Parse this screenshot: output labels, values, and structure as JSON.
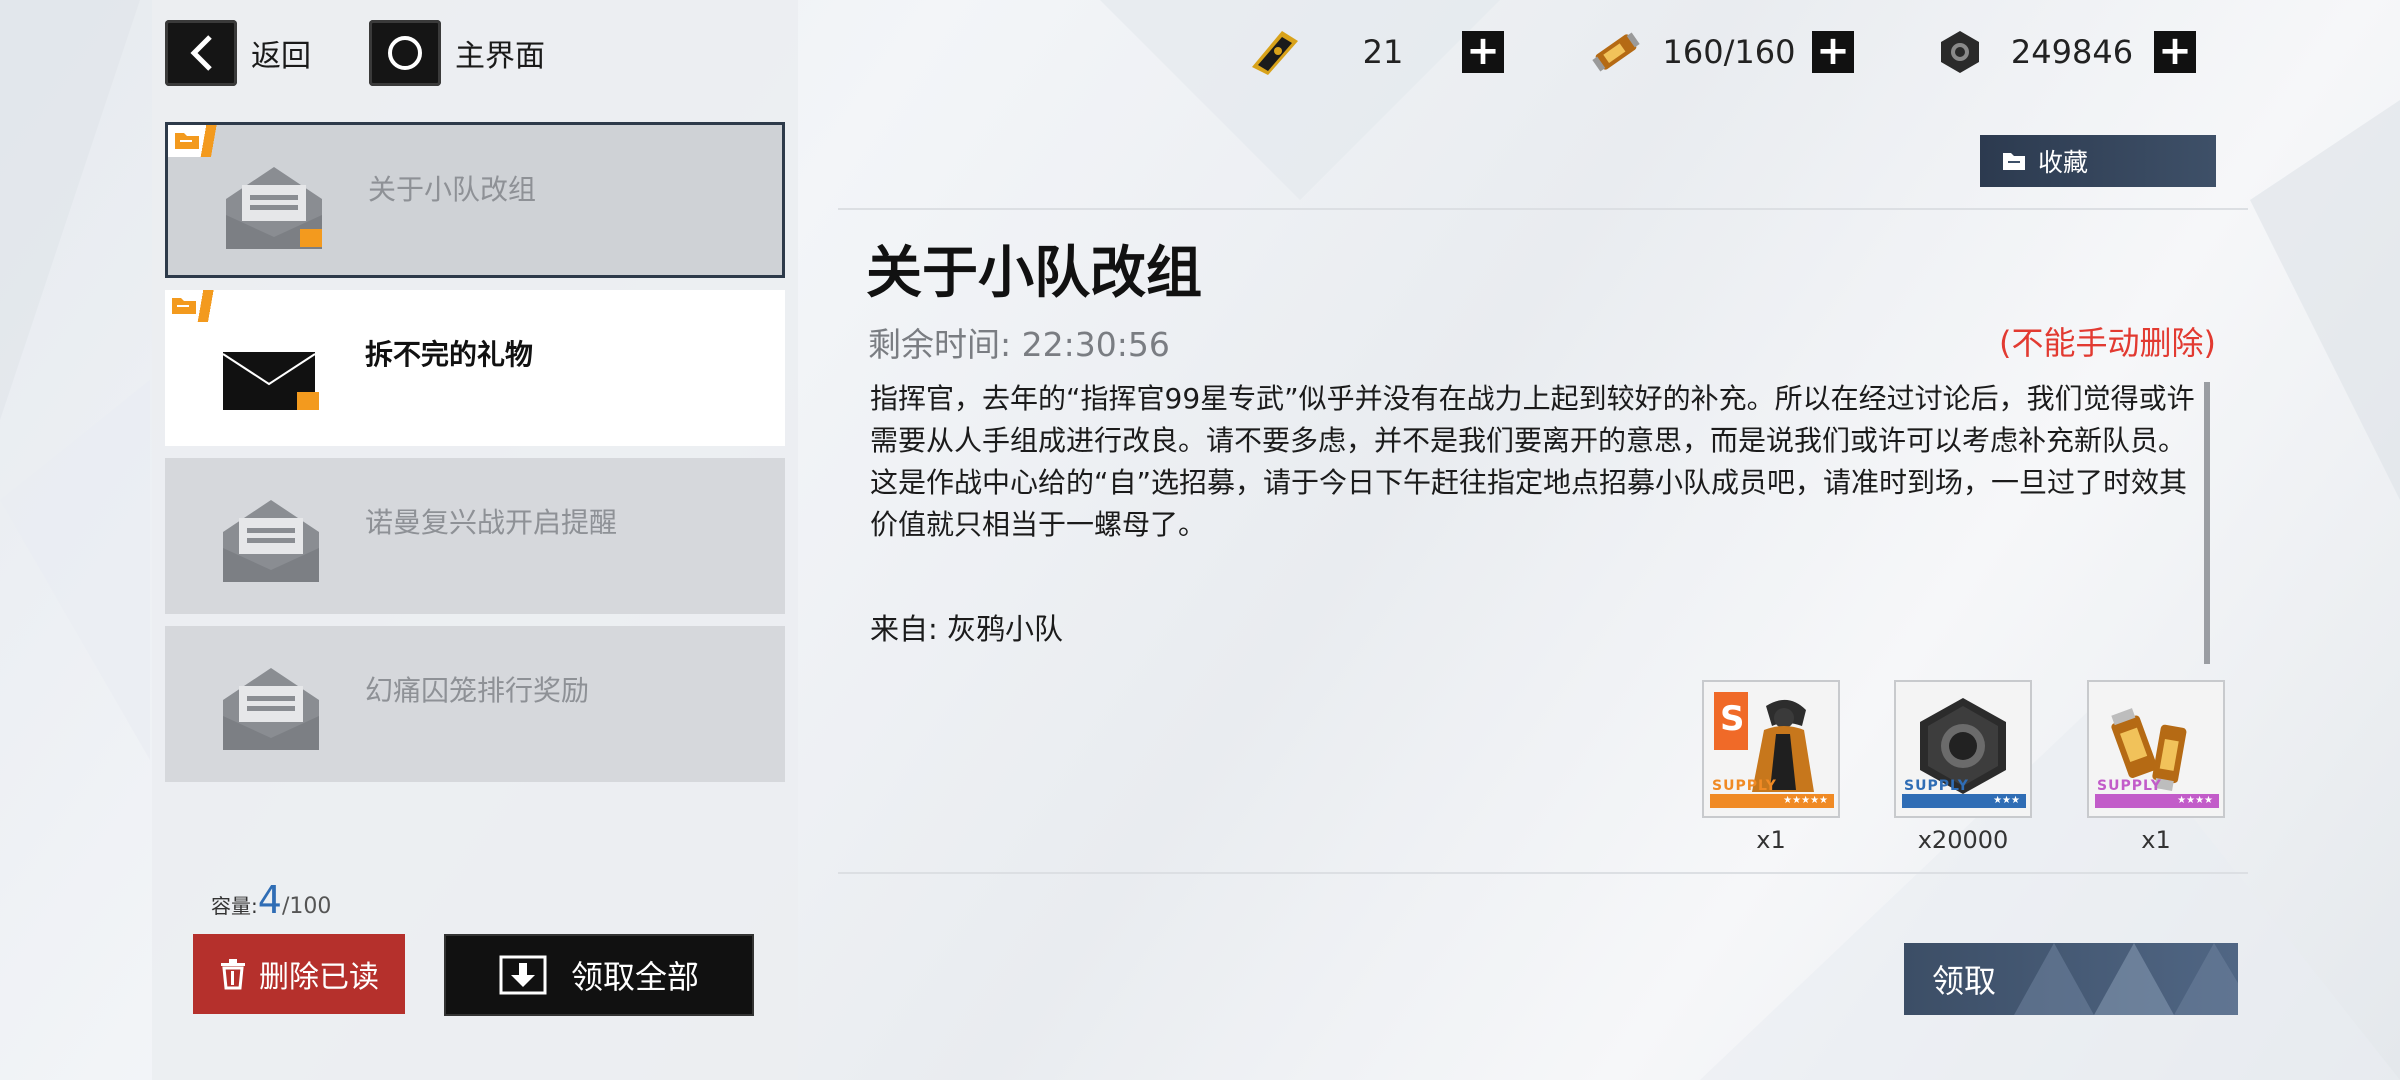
{
  "topnav": {
    "back_label": "返回",
    "home_label": "主界面",
    "back_icon": "chevron-left-icon",
    "home_icon": "circle-icon"
  },
  "resources": [
    {
      "icon": "ticket-icon",
      "value": "21"
    },
    {
      "icon": "battery-icon",
      "value": "160/160"
    },
    {
      "icon": "nut-icon",
      "value": "249846"
    }
  ],
  "mail_list": [
    {
      "title": "关于小队改组",
      "state": "selected",
      "icon": "envelope-open-icon"
    },
    {
      "title": "拆不完的礼物",
      "state": "active",
      "icon": "envelope-closed-icon"
    },
    {
      "title": "诺曼复兴战开启提醒",
      "state": "read",
      "icon": "envelope-open-icon"
    },
    {
      "title": "幻痛囚笼排行奖励",
      "state": "read",
      "icon": "envelope-open-icon"
    }
  ],
  "capacity": {
    "label": "容量:",
    "current": "4",
    "max": "/100"
  },
  "buttons": {
    "delete_read": "删除已读",
    "claim_all": "领取全部",
    "favorite": "收藏",
    "claim": "领取"
  },
  "detail": {
    "title": "关于小队改组",
    "remaining_label": "剩余时间:",
    "remaining_time": "22:30:56",
    "no_delete_notice": "(不能手动删除)",
    "body": "指挥官，去年的“指挥官99星专武”似乎并没有在战力上起到较好的补充。所以在经过讨论后，我们觉得或许需要从人手组成进行改良。请不要多虑，并不是我们要离开的意思，而是说我们或许可以考虑补充新队员。这是作战中心给的“自”选招募，请于今日下午赶往指定地点招募小队成员吧，请准时到场，一旦过了时效其价值就只相当于一螺母了。",
    "sender_label": "来自:",
    "sender": "灰鸦小队"
  },
  "rewards": [
    {
      "icon": "character-recruit-icon",
      "supply": "SUPPLY",
      "qty": "x1",
      "color": "#f08a24",
      "stars": "★★★★★"
    },
    {
      "icon": "nut-icon",
      "supply": "SUPPLY",
      "qty": "x20000",
      "color": "#2f6db5",
      "stars": "★★★"
    },
    {
      "icon": "battery-icon",
      "supply": "SUPPLY",
      "qty": "x1",
      "color": "#c25cc9",
      "stars": "★★★★"
    }
  ],
  "colors": {
    "accent_blue": "#2f6db5",
    "danger_red": "#b5302c",
    "notice_red": "#e23a31",
    "tag_orange": "#f39a1e",
    "button_navy": "#2c3a4f"
  }
}
